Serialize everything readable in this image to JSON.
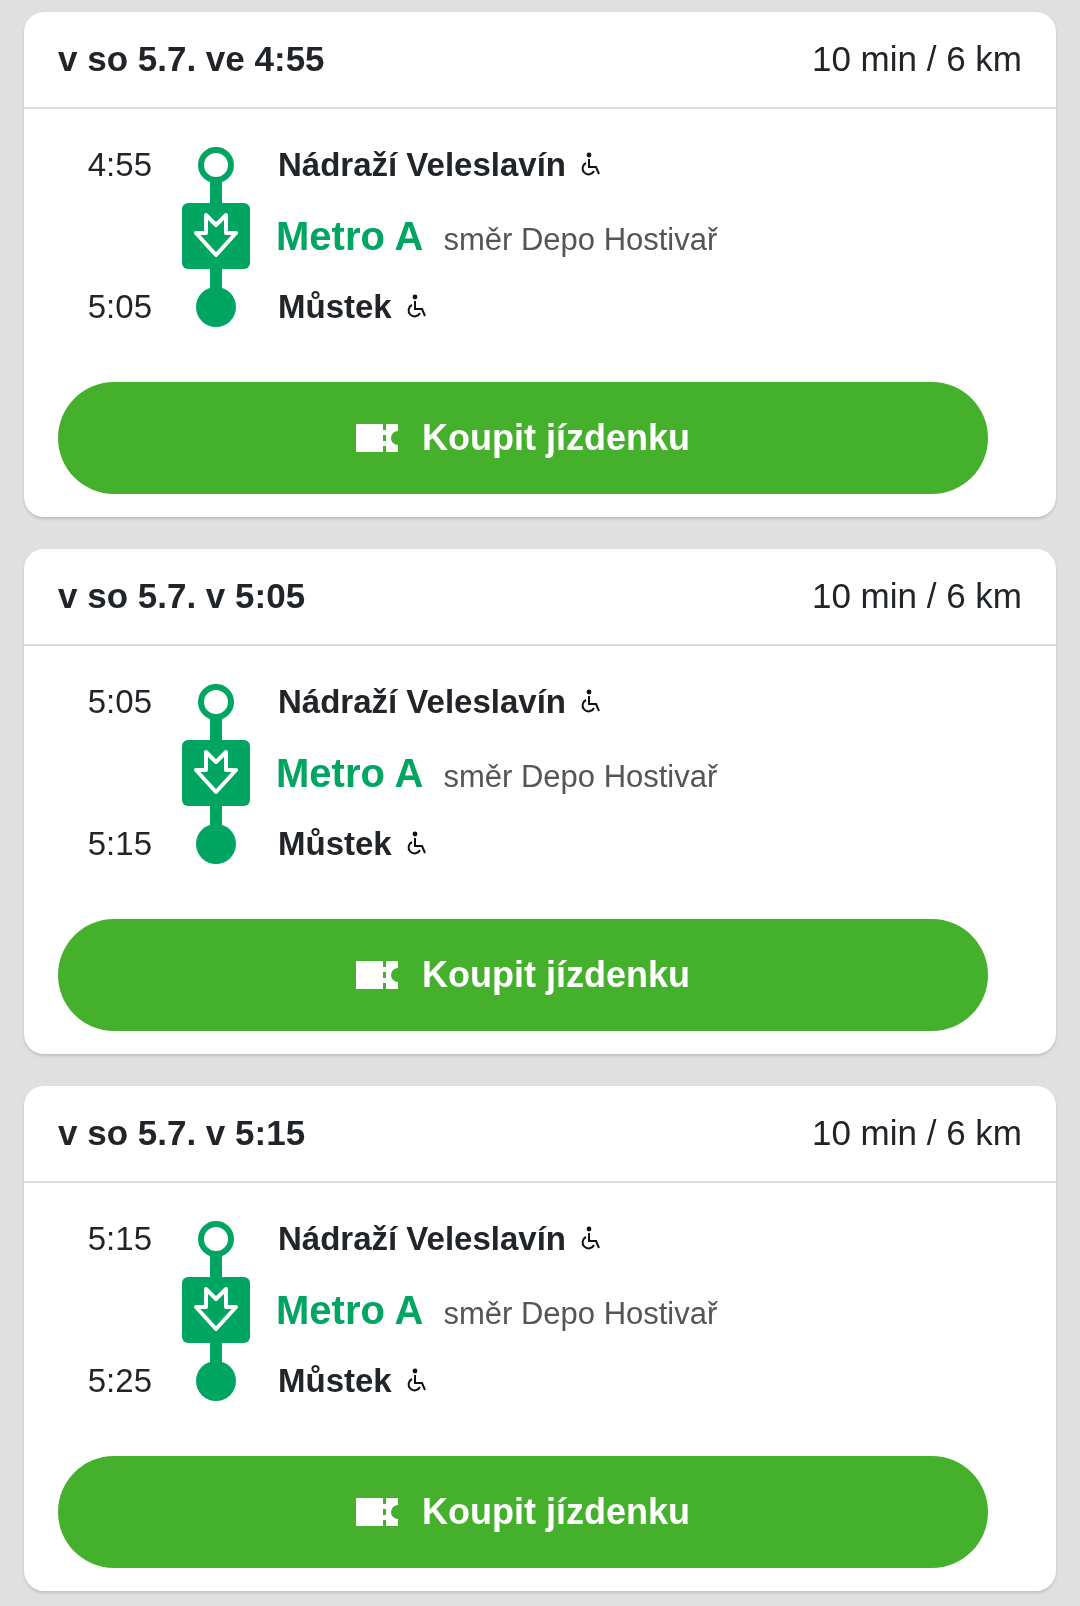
{
  "trips": [
    {
      "header": "v so 5.7. ve 4:55",
      "duration": "10 min / 6 km",
      "from": {
        "time": "4:55",
        "station": "Nádraží Veleslavín",
        "accessible": true
      },
      "line": {
        "name": "Metro A",
        "direction": "směr Depo Hostivař"
      },
      "to": {
        "time": "5:05",
        "station": "Můstek",
        "accessible": true
      },
      "button": "Koupit jízdenku"
    },
    {
      "header": "v so 5.7. v 5:05",
      "duration": "10 min / 6 km",
      "from": {
        "time": "5:05",
        "station": "Nádraží Veleslavín",
        "accessible": true
      },
      "line": {
        "name": "Metro A",
        "direction": "směr Depo Hostivař"
      },
      "to": {
        "time": "5:15",
        "station": "Můstek",
        "accessible": true
      },
      "button": "Koupit jízdenku"
    },
    {
      "header": "v so 5.7. v 5:15",
      "duration": "10 min / 6 km",
      "from": {
        "time": "5:15",
        "station": "Nádraží Veleslavín",
        "accessible": true
      },
      "line": {
        "name": "Metro A",
        "direction": "směr Depo Hostivař"
      },
      "to": {
        "time": "5:25",
        "station": "Můstek",
        "accessible": true
      },
      "button": "Koupit jízdenku"
    }
  ]
}
